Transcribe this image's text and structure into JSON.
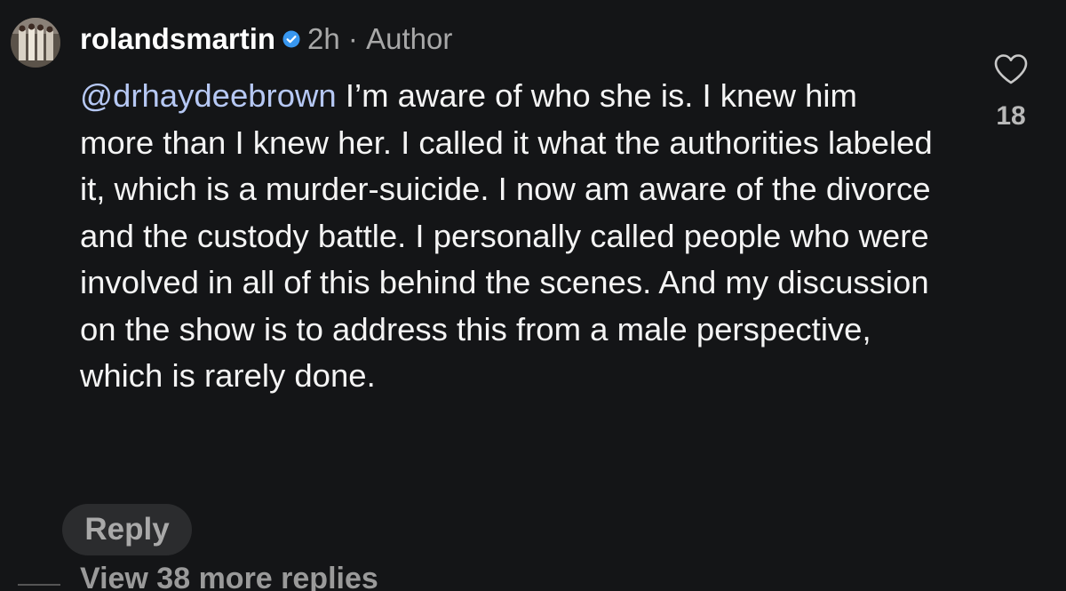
{
  "comment": {
    "username": "rolandsmartin",
    "verified_icon": "verified-badge-icon",
    "time_ago": "2h",
    "separator": " · ",
    "role": "Author",
    "mention": "@drhaydeebrown",
    "text": "I’m aware of who she is. I knew him more than I knew her. I called it what the authorities labeled it, which is a murder-suicide. I now am aware of the divorce and the custody battle. I personally called people who were involved in all of this behind the scenes. And my discussion on the show is to address this from a male perspective, which is rarely done.",
    "like_icon": "heart-outline-icon",
    "like_count": "18",
    "reply_label": "Reply",
    "view_replies_label": "View 38 more replies"
  },
  "colors": {
    "background": "#141517",
    "mention": "#b6c8f4",
    "verified": "#3897f0",
    "meta": "#a8a8a8"
  }
}
